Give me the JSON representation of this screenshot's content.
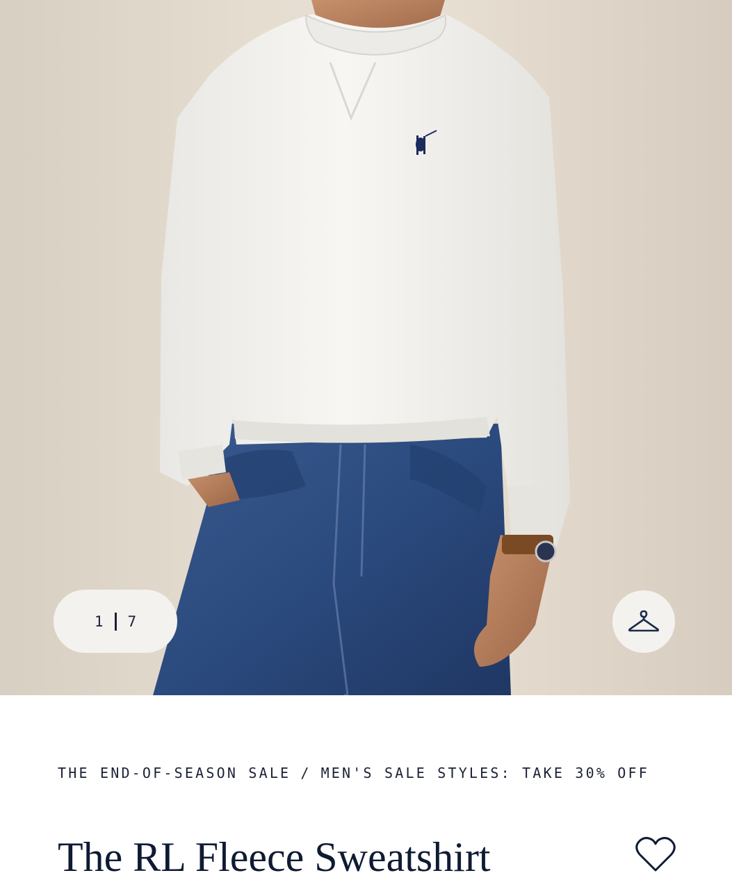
{
  "gallery": {
    "current_index": "1",
    "total": "7",
    "image_subject": "model wearing white crewneck sweatshirt with navy pony logo and blue jeans",
    "hanger_icon": "hanger-icon"
  },
  "breadcrumb": {
    "items": [
      "THE END-OF-SEASON SALE",
      "MEN'S SALE STYLES: TAKE 30% OFF"
    ],
    "separator": "/"
  },
  "product": {
    "title": "The RL Fleece Sweatshirt",
    "favorite_icon": "heart-outline-icon"
  },
  "colors": {
    "navy": "#0f1b33",
    "pill_bg": "#f4f2ef"
  }
}
